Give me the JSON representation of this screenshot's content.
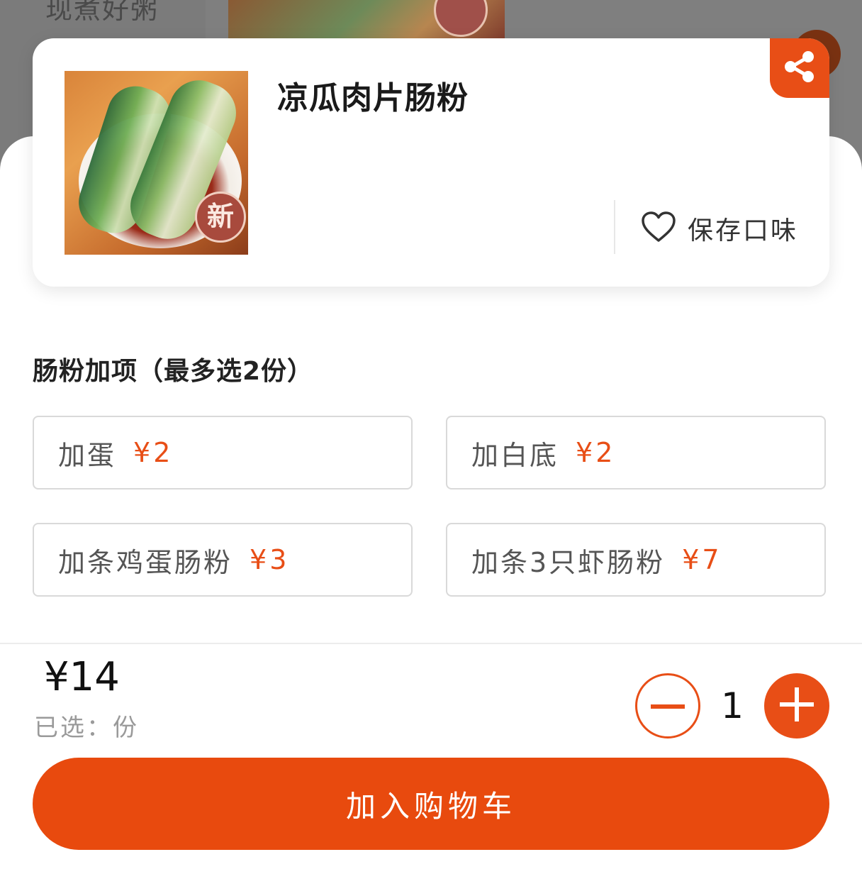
{
  "background": {
    "category_text": "现煮好粥"
  },
  "product": {
    "name": "凉瓜肉片肠粉",
    "save_label": "保存口味",
    "badge_text": "新"
  },
  "addons": {
    "title": "肠粉加项（最多选2份）",
    "options": [
      {
        "name": "加蛋",
        "price": "¥2"
      },
      {
        "name": "加白底",
        "price": "¥2"
      },
      {
        "name": "加条鸡蛋肠粉",
        "price": "¥3"
      },
      {
        "name": "加条3只虾肠粉",
        "price": "¥7"
      }
    ]
  },
  "footer": {
    "total": "¥14",
    "selected": "已选：份",
    "quantity": "1",
    "add_to_cart": "加入购物车"
  },
  "colors": {
    "accent": "#e84e16",
    "text_primary": "#1a1a1a",
    "text_muted": "#9a9a9a"
  }
}
